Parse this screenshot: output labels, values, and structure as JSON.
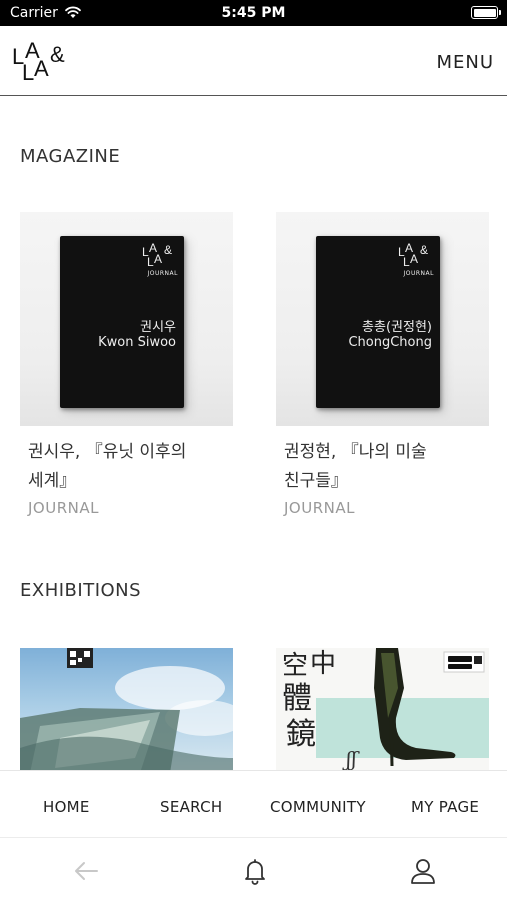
{
  "status_bar": {
    "carrier": "Carrier",
    "time": "5:45 PM",
    "wifi_icon": "wifi-icon",
    "battery_icon": "battery-icon"
  },
  "header": {
    "logo_text": "LALA&",
    "menu_label": "MENU"
  },
  "sections": {
    "magazine": {
      "title": "MAGAZINE",
      "items": [
        {
          "title": "권시우, 『유닛 이후의 세계』",
          "category": "JOURNAL",
          "cover_brand": "LALA&",
          "cover_label": "JOURNAL",
          "cover_name_kr": "권시우",
          "cover_name_en": "Kwon Siwoo"
        },
        {
          "title": "권정현, 『나의 미술 친구들』",
          "category": "JOURNAL",
          "cover_brand": "LALA&",
          "cover_label": "JOURNAL",
          "cover_name_kr": "총총(권정현)",
          "cover_name_en": "ChongChong"
        }
      ]
    },
    "exhibitions": {
      "title": "EXHIBITIONS",
      "items": [
        {
          "image": "exhibition-poster-sky"
        },
        {
          "image": "exhibition-poster-boots",
          "poster_text": "空中體鏡"
        }
      ]
    }
  },
  "tabbar": {
    "tabs": [
      {
        "label": "HOME"
      },
      {
        "label": "SEARCH"
      },
      {
        "label": "COMMUNITY"
      },
      {
        "label": "MY PAGE"
      }
    ],
    "tools": [
      {
        "icon": "back-arrow-icon"
      },
      {
        "icon": "bell-icon"
      },
      {
        "icon": "user-icon"
      }
    ]
  },
  "colors": {
    "text": "#222222",
    "muted": "#999999",
    "divider": "#555555",
    "status_bar": "#000000"
  }
}
